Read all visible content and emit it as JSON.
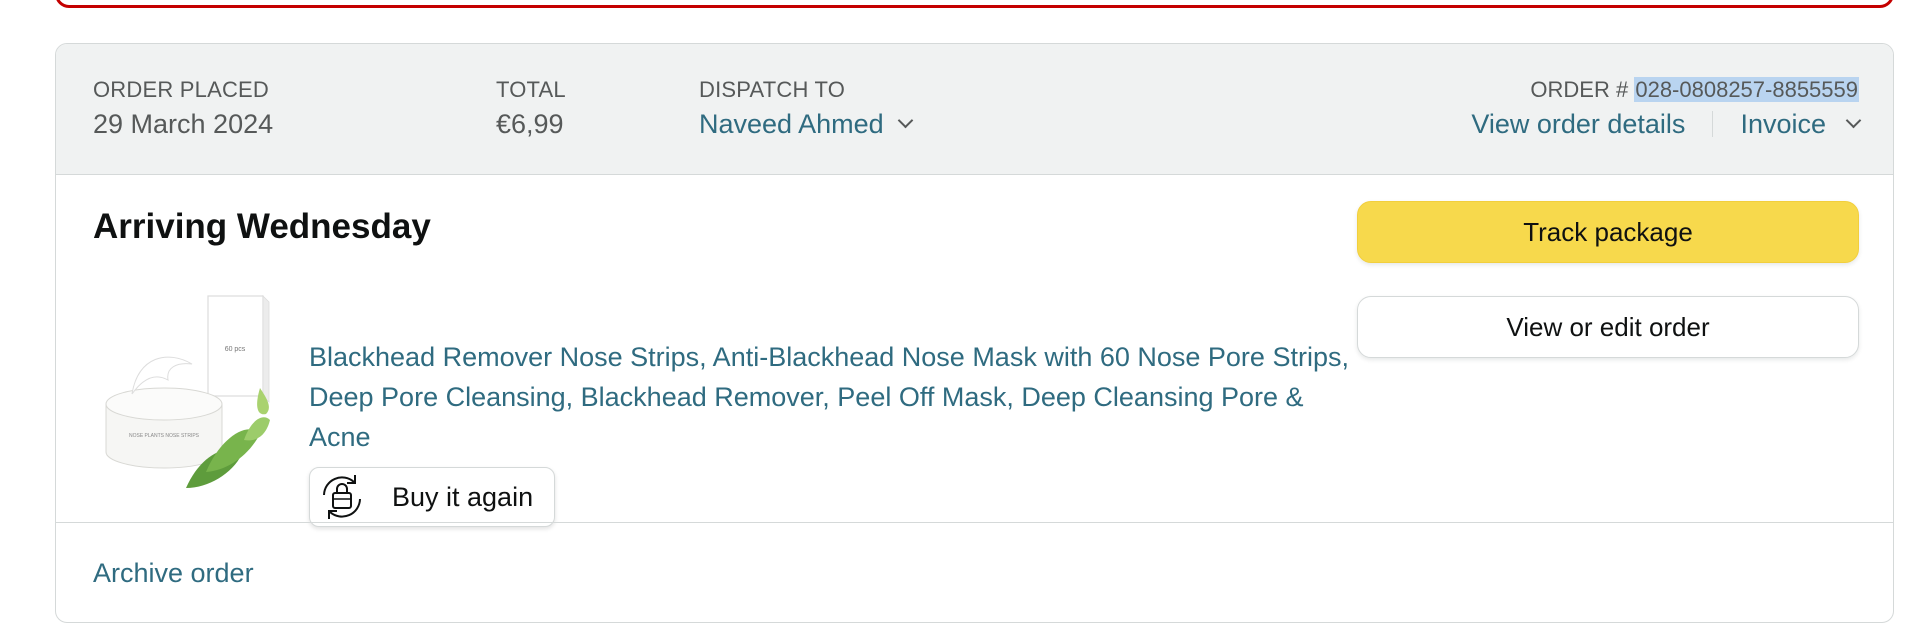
{
  "order": {
    "placed_label": "ORDER PLACED",
    "placed_value": "29 March 2024",
    "total_label": "TOTAL",
    "total_value": "€6,99",
    "dispatch_label": "DISPATCH TO",
    "dispatch_value": "Naveed Ahmed",
    "order_number_prefix": "ORDER # ",
    "order_number": "028-0808257-8855559",
    "view_details_label": "View order details",
    "invoice_label": "Invoice"
  },
  "shipment": {
    "status": "Arriving Wednesday",
    "product_title": "Blackhead Remover Nose Strips, Anti-Blackhead Nose Mask with 60 Nose Pore Strips, Deep Pore Cleansing, Blackhead Remover, Peel Off Mask, Deep Cleansing Pore & Acne",
    "product_image_box_text": "60 pcs",
    "product_image_jar_text": "NOSE PLANTS NOSE STRIPS",
    "buy_again_label": "Buy it again",
    "track_package_label": "Track package",
    "view_edit_label": "View or edit order"
  },
  "footer": {
    "archive_label": "Archive order"
  },
  "colors": {
    "link": "#2f6b80",
    "primary_button": "#f7d94c",
    "header_bg": "#f0f2f2",
    "banner_border": "#c40000",
    "selection_highlight": "#b9d4f0"
  }
}
